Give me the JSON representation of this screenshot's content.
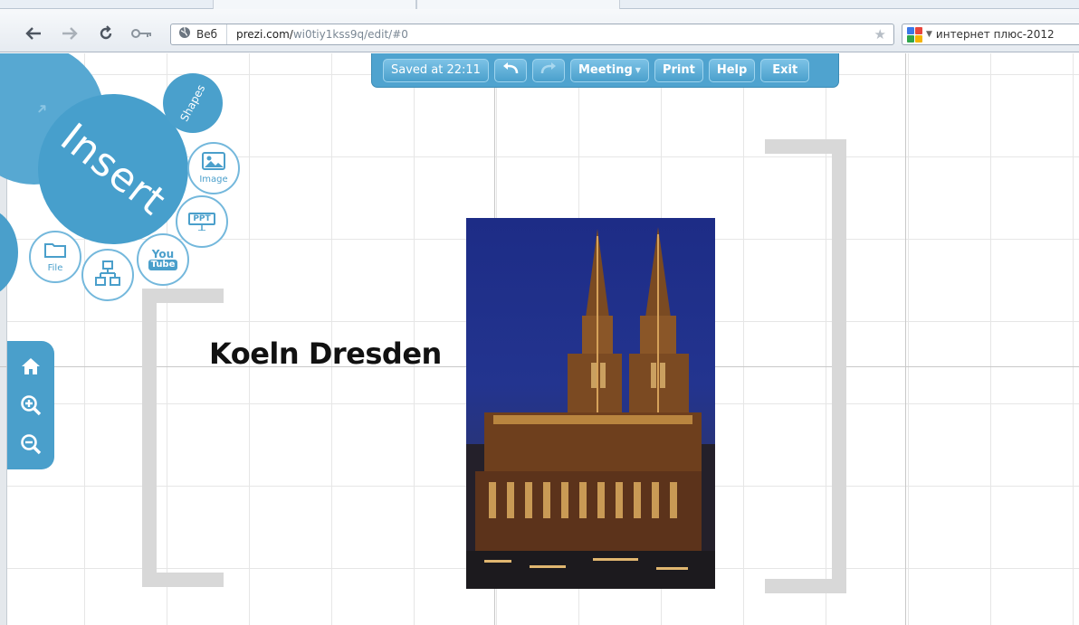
{
  "browser": {
    "omnibox": {
      "site_label": "Веб",
      "url_host": "prezi.com/",
      "url_path": "wi0tiy1kss9q/edit/#0"
    },
    "search": {
      "label": "интернет плюс-2012"
    }
  },
  "prezi_toolbar": {
    "status": "Saved at 22:11",
    "meeting_label": "Meeting",
    "print_label": "Print",
    "help_label": "Help",
    "exit_label": "Exit"
  },
  "insert_menu": {
    "title": "Insert",
    "shapes_label": "Shapes",
    "image_label": "Image",
    "ppt_label": "PPT",
    "youtube_label_top": "You",
    "youtube_label_bottom": "Tube",
    "file_label": "File"
  },
  "canvas": {
    "frame_title": "Koeln Dresden"
  },
  "colors": {
    "prezi_blue": "#4fa3cf",
    "bubble_blue": "#479fcc",
    "bracket_gray": "#d8d8d8"
  },
  "icons": [
    "back-icon",
    "forward-icon",
    "reload-icon",
    "key-icon",
    "globe-icon",
    "star-icon",
    "undo-icon",
    "redo-icon",
    "home-icon",
    "zoom-in-icon",
    "zoom-out-icon",
    "image-icon",
    "ppt-icon",
    "youtube-icon",
    "file-icon",
    "diagram-icon"
  ]
}
